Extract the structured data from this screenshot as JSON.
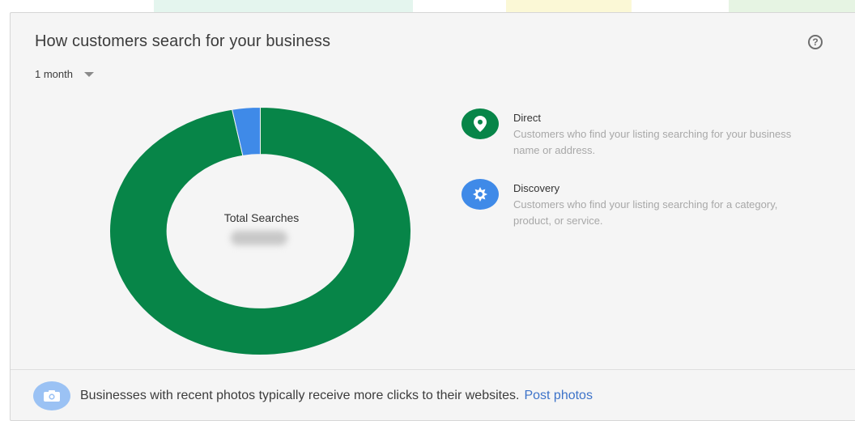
{
  "card": {
    "title": "How customers search for your business",
    "period": {
      "selected": "1 month"
    }
  },
  "total": {
    "label": "Total Searches"
  },
  "legend": [
    {
      "name": "Direct",
      "description": "Customers who find your listing searching for your business name or address.",
      "color": "#078548",
      "icon": "location-pin-icon"
    },
    {
      "name": "Discovery",
      "description": "Customers who find your listing searching for a category, product, or service.",
      "color": "#3f8ae8",
      "icon": "discovery-icon"
    }
  ],
  "footer": {
    "text": "Businesses with recent photos typically receive more clicks to their websites.",
    "link": "Post photos",
    "icon": "camera-icon"
  },
  "chart_data": {
    "type": "pie",
    "series": [
      {
        "name": "Direct",
        "value": 97,
        "color": "#078548"
      },
      {
        "name": "Discovery",
        "value": 3,
        "color": "#3f8ae8"
      }
    ],
    "center_label": "Total Searches",
    "unit": "percent"
  }
}
